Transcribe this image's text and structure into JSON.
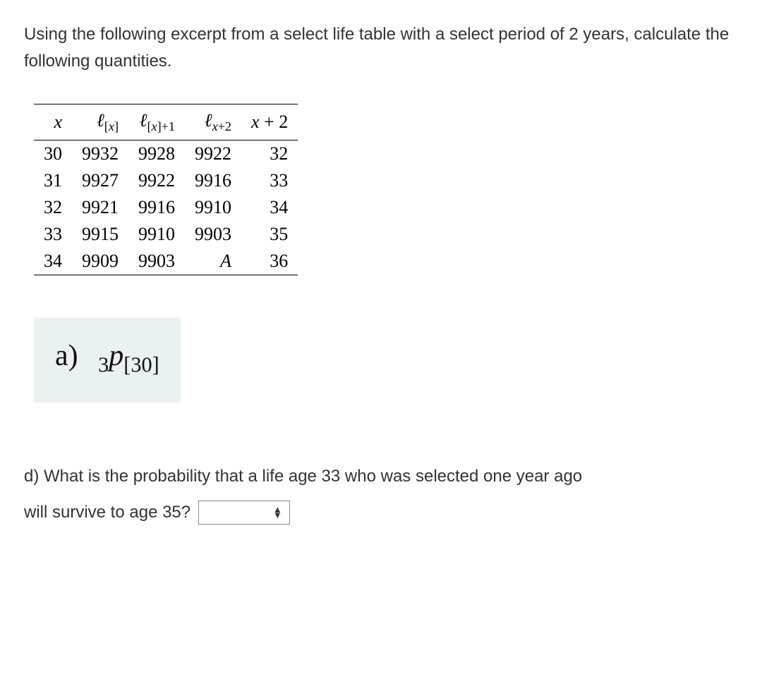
{
  "prompt": "Using the following excerpt from a select life table with a select period of 2 years, calculate the following quantities.",
  "table": {
    "headers": {
      "x": "x",
      "lx": "ℓ",
      "lx_sub": "[x]",
      "lx1": "ℓ",
      "lx1_sub": "[x]+1",
      "lx2": "ℓ",
      "lx2_sub": "x+2",
      "xp2": "x + 2"
    },
    "rows": [
      {
        "x": "30",
        "lx": "9932",
        "lx1": "9928",
        "lx2": "9922",
        "xp2": "32"
      },
      {
        "x": "31",
        "lx": "9927",
        "lx1": "9922",
        "lx2": "9916",
        "xp2": "33"
      },
      {
        "x": "32",
        "lx": "9921",
        "lx1": "9916",
        "lx2": "9910",
        "xp2": "34"
      },
      {
        "x": "33",
        "lx": "9915",
        "lx1": "9910",
        "lx2": "9903",
        "xp2": "35"
      },
      {
        "x": "34",
        "lx": "9909",
        "lx1": "9903",
        "lx2": "A",
        "xp2": "36"
      }
    ]
  },
  "part_a": {
    "label": "a)",
    "pre": "3",
    "var": "p",
    "post": "[30]"
  },
  "part_d": {
    "line1": "d) What is the probability that a life age 33 who was selected one year ago",
    "line2_prefix": "will survive to age 35?"
  },
  "chart_data": {
    "type": "table",
    "title": "Select life table excerpt (select period 2 years)",
    "columns": [
      "x",
      "l[x]",
      "l[x]+1",
      "l_{x+2}",
      "x+2"
    ],
    "rows": [
      [
        30,
        9932,
        9928,
        9922,
        32
      ],
      [
        31,
        9927,
        9922,
        9916,
        33
      ],
      [
        32,
        9921,
        9916,
        9910,
        34
      ],
      [
        33,
        9915,
        9910,
        9903,
        35
      ],
      [
        34,
        9909,
        9903,
        "A",
        36
      ]
    ]
  }
}
